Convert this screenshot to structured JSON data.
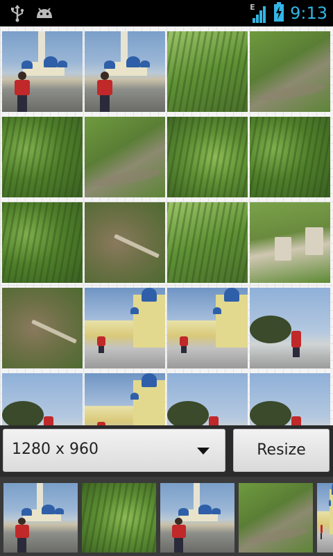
{
  "status_bar": {
    "time": "9:13",
    "network_type": "E",
    "icons": [
      "usb-icon",
      "android-debug-icon",
      "signal-icon",
      "battery-charging-icon"
    ]
  },
  "gallery": {
    "photos": [
      {
        "name": "photo-mosque-child-1",
        "kind": "mosque"
      },
      {
        "name": "photo-mosque-child-2",
        "kind": "mosque"
      },
      {
        "name": "photo-grass-tilted",
        "kind": "grass3"
      },
      {
        "name": "photo-grass-path-1",
        "kind": "path"
      },
      {
        "name": "photo-grass-rotated-1",
        "kind": "grass1"
      },
      {
        "name": "photo-grass-rotated-2",
        "kind": "path"
      },
      {
        "name": "photo-grass-rotated-3",
        "kind": "grass2"
      },
      {
        "name": "photo-grass-rotated-4",
        "kind": "grass1"
      },
      {
        "name": "photo-grass-rotated-5",
        "kind": "grass1"
      },
      {
        "name": "photo-grass-dirt-1",
        "kind": "dirt"
      },
      {
        "name": "photo-grass-rotated-6",
        "kind": "grass3"
      },
      {
        "name": "photo-grass-steps",
        "kind": "steps"
      },
      {
        "name": "photo-ground-branch",
        "kind": "dirt"
      },
      {
        "name": "photo-mosque-side-1",
        "kind": "mosqueside"
      },
      {
        "name": "photo-mosque-side-2",
        "kind": "mosqueside"
      },
      {
        "name": "photo-people-tree",
        "kind": "treesky"
      },
      {
        "name": "photo-mosque-rotated-1",
        "kind": "treesky"
      },
      {
        "name": "photo-mosque-rotated-2",
        "kind": "mosqueside"
      },
      {
        "name": "photo-tree-rotated",
        "kind": "treesky"
      },
      {
        "name": "photo-people-rotated",
        "kind": "treesky"
      }
    ]
  },
  "controls": {
    "resolution_selected": "1280 x 960",
    "resize_label": "Resize"
  },
  "filmstrip": {
    "items": [
      {
        "name": "film-mosque-child-1",
        "kind": "mosque"
      },
      {
        "name": "film-grass-1",
        "kind": "grass2"
      },
      {
        "name": "film-mosque-child-2",
        "kind": "mosque"
      },
      {
        "name": "film-grass-path",
        "kind": "path"
      },
      {
        "name": "film-partial",
        "kind": "mosqueside"
      }
    ]
  },
  "colors": {
    "accent": "#33b5e5",
    "status_bar_bg": "#000000",
    "controls_bg": "#2b2b2b",
    "filmstrip_bg": "#3a3a3a"
  }
}
